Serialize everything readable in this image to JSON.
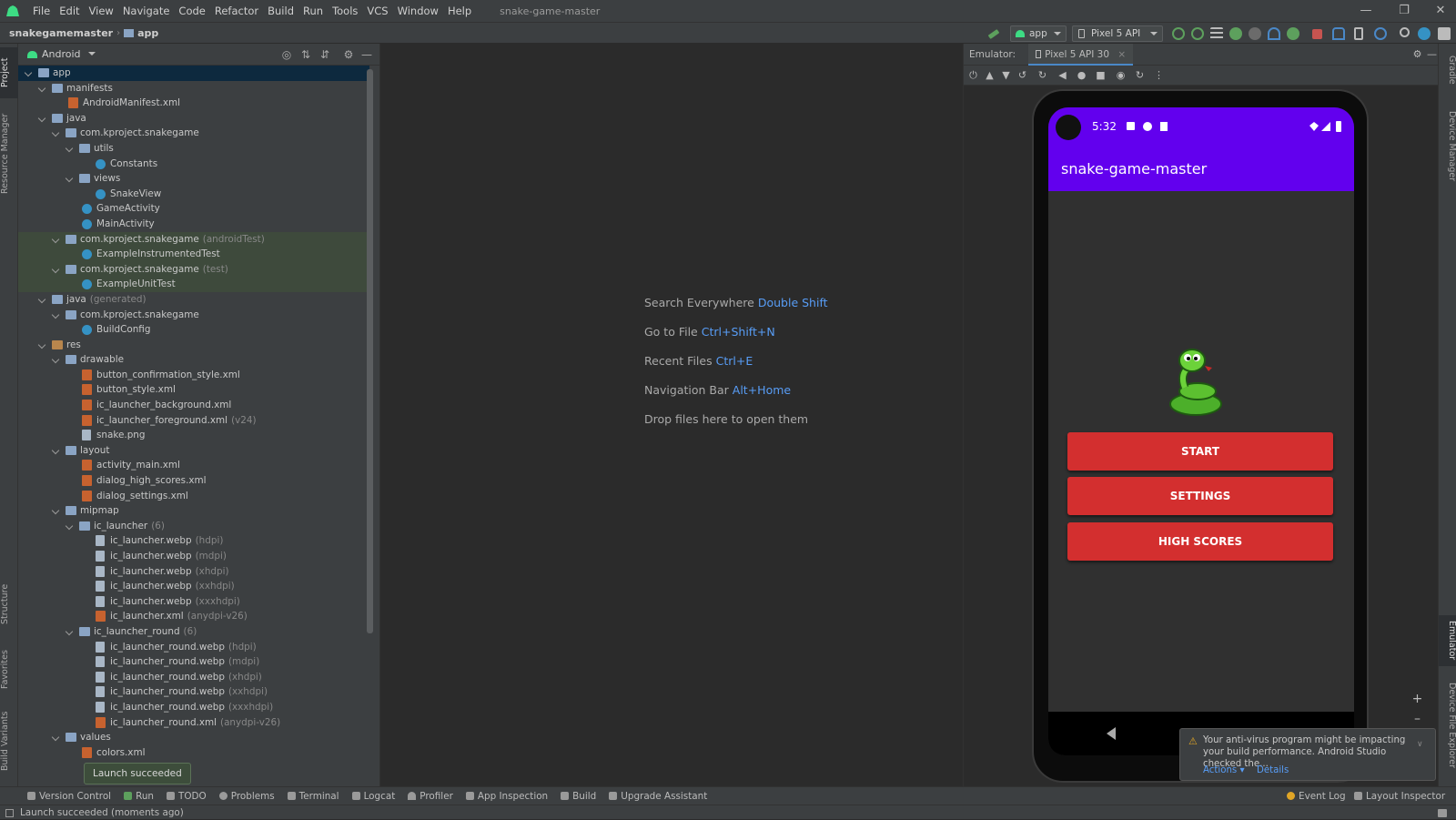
{
  "menubar": {
    "items": [
      "File",
      "Edit",
      "View",
      "Navigate",
      "Code",
      "Refactor",
      "Build",
      "Run",
      "Tools",
      "VCS",
      "Window",
      "Help"
    ],
    "project_title": "snake-game-master"
  },
  "navbar": {
    "crumbs": [
      "snakegamemaster",
      "app"
    ],
    "run_config": "app",
    "device": "Pixel 5 API 30"
  },
  "left_stripe": [
    "Project",
    "Resource Manager",
    "Structure",
    "Favorites",
    "Build Variants"
  ],
  "right_stripe": [
    "Gradle",
    "Device Manager",
    "Emulator",
    "Device File Explorer"
  ],
  "project": {
    "view_mode": "Android",
    "tree": [
      {
        "label": "app",
        "suffix": "",
        "depth": 0,
        "type": "folder",
        "expanded": true,
        "state": "sel"
      },
      {
        "label": "manifests",
        "suffix": "",
        "depth": 1,
        "type": "folder",
        "expanded": true
      },
      {
        "label": "AndroidManifest.xml",
        "suffix": "",
        "depth": 2,
        "type": "xml"
      },
      {
        "label": "java",
        "suffix": "",
        "depth": 1,
        "type": "folder",
        "expanded": true
      },
      {
        "label": "com.kproject.snakegame",
        "suffix": "",
        "depth": 2,
        "type": "pkg",
        "expanded": true
      },
      {
        "label": "utils",
        "suffix": "",
        "depth": 3,
        "type": "pkg",
        "expanded": true
      },
      {
        "label": "Constants",
        "suffix": "",
        "depth": 4,
        "type": "cls"
      },
      {
        "label": "views",
        "suffix": "",
        "depth": 3,
        "type": "pkg",
        "expanded": true
      },
      {
        "label": "SnakeView",
        "suffix": "",
        "depth": 4,
        "type": "cls"
      },
      {
        "label": "GameActivity",
        "suffix": "",
        "depth": 3,
        "type": "cls"
      },
      {
        "label": "MainActivity",
        "suffix": "",
        "depth": 3,
        "type": "cls"
      },
      {
        "label": "com.kproject.snakegame",
        "suffix": "(androidTest)",
        "depth": 2,
        "type": "pkg",
        "expanded": true,
        "state": "hl"
      },
      {
        "label": "ExampleInstrumentedTest",
        "suffix": "",
        "depth": 3,
        "type": "cls",
        "state": "hl"
      },
      {
        "label": "com.kproject.snakegame",
        "suffix": "(test)",
        "depth": 2,
        "type": "pkg",
        "expanded": true,
        "state": "hl"
      },
      {
        "label": "ExampleUnitTest",
        "suffix": "",
        "depth": 3,
        "type": "cls",
        "state": "hl"
      },
      {
        "label": "java",
        "suffix": "(generated)",
        "depth": 1,
        "type": "folder",
        "expanded": true
      },
      {
        "label": "com.kproject.snakegame",
        "suffix": "",
        "depth": 2,
        "type": "pkg",
        "expanded": true
      },
      {
        "label": "BuildConfig",
        "suffix": "",
        "depth": 3,
        "type": "cls"
      },
      {
        "label": "res",
        "suffix": "",
        "depth": 1,
        "type": "res",
        "expanded": true
      },
      {
        "label": "drawable",
        "suffix": "",
        "depth": 2,
        "type": "folder",
        "expanded": true
      },
      {
        "label": "button_confirmation_style.xml",
        "suffix": "",
        "depth": 3,
        "type": "xml"
      },
      {
        "label": "button_style.xml",
        "suffix": "",
        "depth": 3,
        "type": "xml"
      },
      {
        "label": "ic_launcher_background.xml",
        "suffix": "",
        "depth": 3,
        "type": "xml"
      },
      {
        "label": "ic_launcher_foreground.xml",
        "suffix": "(v24)",
        "depth": 3,
        "type": "xml"
      },
      {
        "label": "snake.png",
        "suffix": "",
        "depth": 3,
        "type": "file"
      },
      {
        "label": "layout",
        "suffix": "",
        "depth": 2,
        "type": "folder",
        "expanded": true
      },
      {
        "label": "activity_main.xml",
        "suffix": "",
        "depth": 3,
        "type": "xml"
      },
      {
        "label": "dialog_high_scores.xml",
        "suffix": "",
        "depth": 3,
        "type": "xml"
      },
      {
        "label": "dialog_settings.xml",
        "suffix": "",
        "depth": 3,
        "type": "xml"
      },
      {
        "label": "mipmap",
        "suffix": "",
        "depth": 2,
        "type": "folder",
        "expanded": true
      },
      {
        "label": "ic_launcher",
        "suffix": "(6)",
        "depth": 3,
        "type": "folder",
        "expanded": true
      },
      {
        "label": "ic_launcher.webp",
        "suffix": "(hdpi)",
        "depth": 4,
        "type": "file"
      },
      {
        "label": "ic_launcher.webp",
        "suffix": "(mdpi)",
        "depth": 4,
        "type": "file"
      },
      {
        "label": "ic_launcher.webp",
        "suffix": "(xhdpi)",
        "depth": 4,
        "type": "file"
      },
      {
        "label": "ic_launcher.webp",
        "suffix": "(xxhdpi)",
        "depth": 4,
        "type": "file"
      },
      {
        "label": "ic_launcher.webp",
        "suffix": "(xxxhdpi)",
        "depth": 4,
        "type": "file"
      },
      {
        "label": "ic_launcher.xml",
        "suffix": "(anydpi-v26)",
        "depth": 4,
        "type": "xml"
      },
      {
        "label": "ic_launcher_round",
        "suffix": "(6)",
        "depth": 3,
        "type": "folder",
        "expanded": true
      },
      {
        "label": "ic_launcher_round.webp",
        "suffix": "(hdpi)",
        "depth": 4,
        "type": "file"
      },
      {
        "label": "ic_launcher_round.webp",
        "suffix": "(mdpi)",
        "depth": 4,
        "type": "file"
      },
      {
        "label": "ic_launcher_round.webp",
        "suffix": "(xhdpi)",
        "depth": 4,
        "type": "file"
      },
      {
        "label": "ic_launcher_round.webp",
        "suffix": "(xxhdpi)",
        "depth": 4,
        "type": "file"
      },
      {
        "label": "ic_launcher_round.webp",
        "suffix": "(xxxhdpi)",
        "depth": 4,
        "type": "file"
      },
      {
        "label": "ic_launcher_round.xml",
        "suffix": "(anydpi-v26)",
        "depth": 4,
        "type": "xml"
      },
      {
        "label": "values",
        "suffix": "",
        "depth": 2,
        "type": "folder",
        "expanded": true
      },
      {
        "label": "colors.xml",
        "suffix": "",
        "depth": 3,
        "type": "xml"
      }
    ]
  },
  "editor": {
    "hints": [
      {
        "label": "Search Everywhere",
        "key": "Double Shift"
      },
      {
        "label": "Go to File",
        "key": "Ctrl+Shift+N"
      },
      {
        "label": "Recent Files",
        "key": "Ctrl+E"
      },
      {
        "label": "Navigation Bar",
        "key": "Alt+Home"
      },
      {
        "label": "Drop files here to open them",
        "key": ""
      }
    ]
  },
  "emulator": {
    "label": "Emulator:",
    "tab": "Pixel 5 API 30",
    "phone": {
      "time": "5:32",
      "app_title": "snake-game-master",
      "buttons": [
        "START",
        "SETTINGS",
        "HIGH SCORES"
      ]
    }
  },
  "notification": {
    "text": "Your anti-virus program might be impacting your build performance. Android Studio checked the...",
    "actions": "Actions",
    "details": "Details"
  },
  "toast": "Launch succeeded",
  "bottom_tools": [
    "Version Control",
    "Run",
    "TODO",
    "Problems",
    "Terminal",
    "Logcat",
    "Profiler",
    "App Inspection",
    "Build",
    "Upgrade Assistant"
  ],
  "bottom_right_tools": [
    "Event Log",
    "Layout Inspector"
  ],
  "status_text": "Launch succeeded (moments ago)",
  "colors": {
    "accent": "#6200ee",
    "button": "#d32f2f",
    "link": "#589df6"
  }
}
